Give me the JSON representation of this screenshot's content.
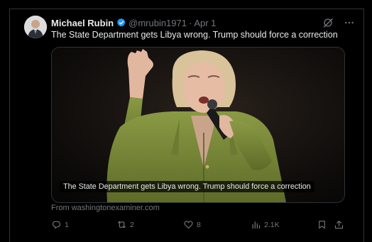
{
  "tweet": {
    "author_name": "Michael Rubin",
    "handle": "@mrubin1971",
    "separator": "·",
    "date": "Apr 1",
    "text": "The State Department gets Libya wrong. Trump should force a correction",
    "card": {
      "caption": "The State Department gets Libya wrong. Trump should force a correction",
      "source": "From washingtonexaminer.com"
    },
    "stats": {
      "replies": "1",
      "reposts": "2",
      "likes": "8",
      "views": "2.1K"
    }
  },
  "icons": {
    "verified": "verified-badge-icon",
    "grok": "grok-icon",
    "more": "more-icon",
    "reply": "reply-icon",
    "repost": "repost-icon",
    "like": "like-icon",
    "views": "views-icon",
    "bookmark": "bookmark-icon",
    "share": "share-icon"
  },
  "colors": {
    "background": "#000000",
    "text": "#e7e9ea",
    "muted": "#71767b",
    "border": "#2f3336",
    "verified": "#1d9bf0",
    "jacket": "#7a8a3a"
  }
}
